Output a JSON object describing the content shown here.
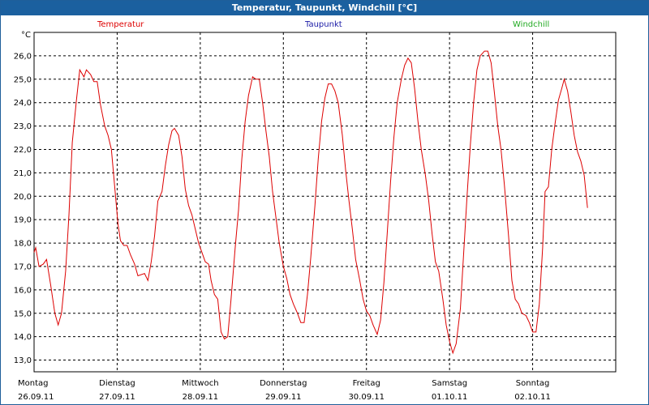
{
  "window": {
    "title": "Temperatur, Taupunkt, Windchill [°C]"
  },
  "legend": [
    {
      "name": "Temperatur",
      "color": "#dd0000"
    },
    {
      "name": "Taupunkt",
      "color": "#1a1aa6"
    },
    {
      "name": "Windchill",
      "color": "#22aa22"
    }
  ],
  "chart_data": {
    "type": "line",
    "title": "Temperatur, Taupunkt, Windchill [°C]",
    "ylabel": "°C",
    "ylim": [
      12.5,
      27.0
    ],
    "xlim": [
      0,
      7
    ],
    "y_ticks": [
      "13,0",
      "14,0",
      "15,0",
      "16,0",
      "17,0",
      "18,0",
      "19,0",
      "20,0",
      "21,0",
      "22,0",
      "23,0",
      "24,0",
      "25,0",
      "26,0"
    ],
    "x_ticks": [
      {
        "x": 0,
        "day": "Montag",
        "date": "26.09.11"
      },
      {
        "x": 1,
        "day": "Dienstag",
        "date": "27.09.11"
      },
      {
        "x": 2,
        "day": "Mittwoch",
        "date": "28.09.11"
      },
      {
        "x": 3,
        "day": "Donnerstag",
        "date": "29.09.11"
      },
      {
        "x": 4,
        "day": "Freitag",
        "date": "30.09.11"
      },
      {
        "x": 5,
        "day": "Samstag",
        "date": "01.10.11"
      },
      {
        "x": 6,
        "day": "Sonntag",
        "date": "02.10.11"
      }
    ],
    "grid": true,
    "legend_position": "top",
    "series": [
      {
        "name": "Temperatur",
        "color": "#dd0000",
        "points": [
          [
            0.0,
            17.6
          ],
          [
            0.02,
            17.8
          ],
          [
            0.06,
            17.0
          ],
          [
            0.11,
            17.1
          ],
          [
            0.15,
            17.3
          ],
          [
            0.2,
            16.2
          ],
          [
            0.25,
            15.0
          ],
          [
            0.29,
            14.5
          ],
          [
            0.33,
            15.0
          ],
          [
            0.38,
            16.8
          ],
          [
            0.42,
            19.2
          ],
          [
            0.46,
            22.3
          ],
          [
            0.51,
            24.1
          ],
          [
            0.55,
            25.4
          ],
          [
            0.6,
            25.1
          ],
          [
            0.63,
            25.4
          ],
          [
            0.68,
            25.2
          ],
          [
            0.72,
            24.9
          ],
          [
            0.76,
            24.9
          ],
          [
            0.8,
            23.9
          ],
          [
            0.85,
            23.0
          ],
          [
            0.89,
            22.6
          ],
          [
            0.93,
            22.0
          ],
          [
            0.97,
            20.4
          ],
          [
            1.01,
            18.8
          ],
          [
            1.04,
            18.1
          ],
          [
            1.08,
            17.9
          ],
          [
            1.12,
            17.9
          ],
          [
            1.16,
            17.5
          ],
          [
            1.21,
            17.1
          ],
          [
            1.25,
            16.6
          ],
          [
            1.33,
            16.7
          ],
          [
            1.37,
            16.4
          ],
          [
            1.41,
            17.2
          ],
          [
            1.45,
            18.3
          ],
          [
            1.49,
            19.8
          ],
          [
            1.54,
            20.2
          ],
          [
            1.58,
            21.3
          ],
          [
            1.62,
            22.2
          ],
          [
            1.66,
            22.8
          ],
          [
            1.69,
            22.9
          ],
          [
            1.74,
            22.6
          ],
          [
            1.78,
            21.7
          ],
          [
            1.82,
            20.3
          ],
          [
            1.86,
            19.6
          ],
          [
            1.9,
            19.2
          ],
          [
            1.94,
            18.6
          ],
          [
            1.98,
            18.0
          ],
          [
            2.02,
            17.6
          ],
          [
            2.06,
            17.2
          ],
          [
            2.1,
            17.1
          ],
          [
            2.13,
            16.4
          ],
          [
            2.17,
            15.8
          ],
          [
            2.21,
            15.6
          ],
          [
            2.25,
            14.2
          ],
          [
            2.29,
            13.9
          ],
          [
            2.33,
            14.0
          ],
          [
            2.37,
            15.6
          ],
          [
            2.42,
            17.8
          ],
          [
            2.46,
            19.4
          ],
          [
            2.5,
            21.6
          ],
          [
            2.54,
            23.2
          ],
          [
            2.58,
            24.3
          ],
          [
            2.63,
            25.1
          ],
          [
            2.67,
            25.0
          ],
          [
            2.71,
            25.0
          ],
          [
            2.75,
            24.0
          ],
          [
            2.79,
            22.8
          ],
          [
            2.83,
            21.7
          ],
          [
            2.87,
            20.2
          ],
          [
            2.91,
            19.1
          ],
          [
            2.95,
            18.0
          ],
          [
            3.0,
            17.0
          ],
          [
            3.04,
            16.5
          ],
          [
            3.08,
            15.8
          ],
          [
            3.12,
            15.4
          ],
          [
            3.17,
            15.0
          ],
          [
            3.21,
            14.6
          ],
          [
            3.25,
            14.6
          ],
          [
            3.29,
            15.8
          ],
          [
            3.33,
            17.4
          ],
          [
            3.38,
            19.6
          ],
          [
            3.42,
            21.6
          ],
          [
            3.46,
            23.2
          ],
          [
            3.5,
            24.2
          ],
          [
            3.54,
            24.8
          ],
          [
            3.58,
            24.8
          ],
          [
            3.62,
            24.5
          ],
          [
            3.66,
            24.0
          ],
          [
            3.71,
            22.6
          ],
          [
            3.75,
            21.1
          ],
          [
            3.79,
            19.8
          ],
          [
            3.83,
            18.6
          ],
          [
            3.87,
            17.3
          ],
          [
            3.92,
            16.4
          ],
          [
            3.96,
            15.6
          ],
          [
            4.0,
            15.1
          ],
          [
            4.04,
            14.9
          ],
          [
            4.08,
            14.5
          ],
          [
            4.13,
            14.1
          ],
          [
            4.17,
            14.7
          ],
          [
            4.21,
            16.3
          ],
          [
            4.25,
            18.4
          ],
          [
            4.29,
            20.6
          ],
          [
            4.33,
            22.5
          ],
          [
            4.37,
            24.0
          ],
          [
            4.42,
            25.0
          ],
          [
            4.46,
            25.6
          ],
          [
            4.5,
            25.9
          ],
          [
            4.54,
            25.7
          ],
          [
            4.58,
            24.6
          ],
          [
            4.62,
            23.2
          ],
          [
            4.66,
            22.0
          ],
          [
            4.71,
            20.9
          ],
          [
            4.75,
            19.8
          ],
          [
            4.79,
            18.4
          ],
          [
            4.83,
            17.2
          ],
          [
            4.87,
            16.8
          ],
          [
            4.92,
            15.6
          ],
          [
            4.96,
            14.5
          ],
          [
            5.0,
            13.8
          ],
          [
            5.04,
            13.3
          ],
          [
            5.08,
            13.7
          ],
          [
            5.13,
            15.2
          ],
          [
            5.17,
            17.6
          ],
          [
            5.21,
            20.0
          ],
          [
            5.25,
            22.2
          ],
          [
            5.29,
            24.0
          ],
          [
            5.33,
            25.4
          ],
          [
            5.37,
            26.0
          ],
          [
            5.42,
            26.2
          ],
          [
            5.46,
            26.2
          ],
          [
            5.5,
            25.7
          ],
          [
            5.54,
            24.4
          ],
          [
            5.58,
            23.0
          ],
          [
            5.62,
            22.0
          ],
          [
            5.66,
            20.5
          ],
          [
            5.71,
            18.3
          ],
          [
            5.75,
            16.4
          ],
          [
            5.79,
            15.6
          ],
          [
            5.83,
            15.4
          ],
          [
            5.87,
            15.0
          ],
          [
            5.92,
            14.9
          ],
          [
            5.96,
            14.6
          ],
          [
            6.0,
            14.2
          ],
          [
            6.04,
            14.2
          ],
          [
            6.08,
            15.4
          ],
          [
            6.12,
            17.8
          ],
          [
            6.15,
            20.2
          ],
          [
            6.19,
            20.4
          ],
          [
            6.23,
            22.0
          ],
          [
            6.27,
            23.1
          ],
          [
            6.31,
            24.1
          ],
          [
            6.35,
            24.6
          ],
          [
            6.38,
            25.0
          ],
          [
            6.42,
            24.5
          ],
          [
            6.46,
            23.6
          ],
          [
            6.5,
            22.6
          ],
          [
            6.54,
            21.9
          ],
          [
            6.58,
            21.5
          ],
          [
            6.62,
            20.9
          ],
          [
            6.66,
            19.5
          ]
        ]
      }
    ]
  }
}
